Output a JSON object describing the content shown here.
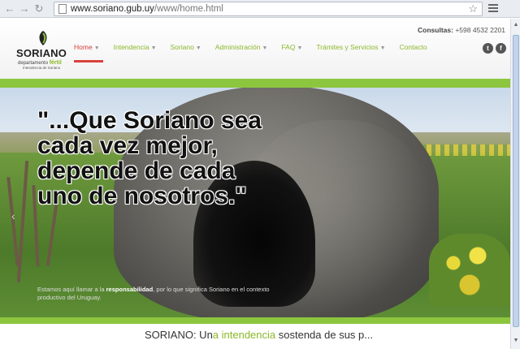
{
  "browser": {
    "url_domain": "www.soriano.gub.uy",
    "url_path": "/www/home.html"
  },
  "header": {
    "contact_label": "Consultas:",
    "contact_phone": "+598 4532 2201",
    "logo": {
      "word": "SORIANO",
      "sub": "departamento",
      "sub_highlight": "fértil",
      "sub2": "Intendencia de Soriano"
    }
  },
  "nav": {
    "items": [
      {
        "label": "Home",
        "has_menu": true
      },
      {
        "label": "Intendencia",
        "has_menu": true
      },
      {
        "label": "Soriano",
        "has_menu": true
      },
      {
        "label": "Administración",
        "has_menu": true
      },
      {
        "label": "FAQ",
        "has_menu": true
      },
      {
        "label": "Trámites y Servicios",
        "has_menu": true
      },
      {
        "label": "Contacto",
        "has_menu": false
      }
    ]
  },
  "social": {
    "twitter": "t",
    "facebook": "f"
  },
  "hero": {
    "quote": "\"...Que Soriano sea cada vez mejor, depende de cada uno de nosotros.\"",
    "caption_pre": "Estamos aquí llamar a la",
    "caption_bold": "responsabilidad",
    "caption_post": ", por lo que significa Soriano en el contexto productivo del Uruguay."
  },
  "bottom": {
    "text_pre": "SORIANO: Un",
    "text_green": "a intendencia",
    "text_post": " sostenda de  sus p..."
  },
  "colors": {
    "accent_green": "#8cc63f",
    "accent_red": "#d9413b"
  }
}
